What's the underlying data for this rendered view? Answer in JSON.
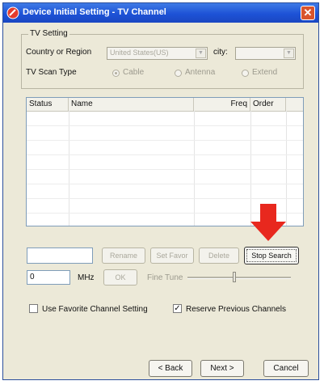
{
  "window": {
    "title": "Device Initial Setting - TV Channel",
    "close_glyph": "✕"
  },
  "tv_setting": {
    "group_label": "TV Setting",
    "country_label": "Country or Region",
    "country_value": "United States(US)",
    "city_label": "city:",
    "city_value": "",
    "scan_type_label": "TV Scan Type",
    "scan_options": [
      {
        "label": "Cable",
        "selected": true
      },
      {
        "label": "Antenna",
        "selected": false
      },
      {
        "label": "Extend",
        "selected": false
      }
    ]
  },
  "channel_list": {
    "columns": [
      "Status",
      "Name",
      "Freq",
      "Order"
    ],
    "rows": []
  },
  "controls": {
    "name_input_value": "",
    "rename_label": "Rename",
    "set_favor_label": "Set Favor",
    "delete_label": "Delete",
    "stop_search_label": "Stop Search",
    "freq_input_value": "0",
    "freq_unit": "MHz",
    "ok_label": "OK",
    "fine_tune_label": "Fine Tune",
    "fine_tune_level": 0.45
  },
  "options": {
    "use_favorite_label": "Use Favorite Channel Setting",
    "use_favorite_checked": false,
    "reserve_previous_label": "Reserve Previous Channels",
    "reserve_previous_checked": true
  },
  "footer": {
    "back_label": "< Back",
    "next_label": "Next >",
    "cancel_label": "Cancel"
  },
  "colors": {
    "title_bar": "#1d52d6",
    "arrow": "#e8281e",
    "dialog_bg": "#ece9d8"
  }
}
